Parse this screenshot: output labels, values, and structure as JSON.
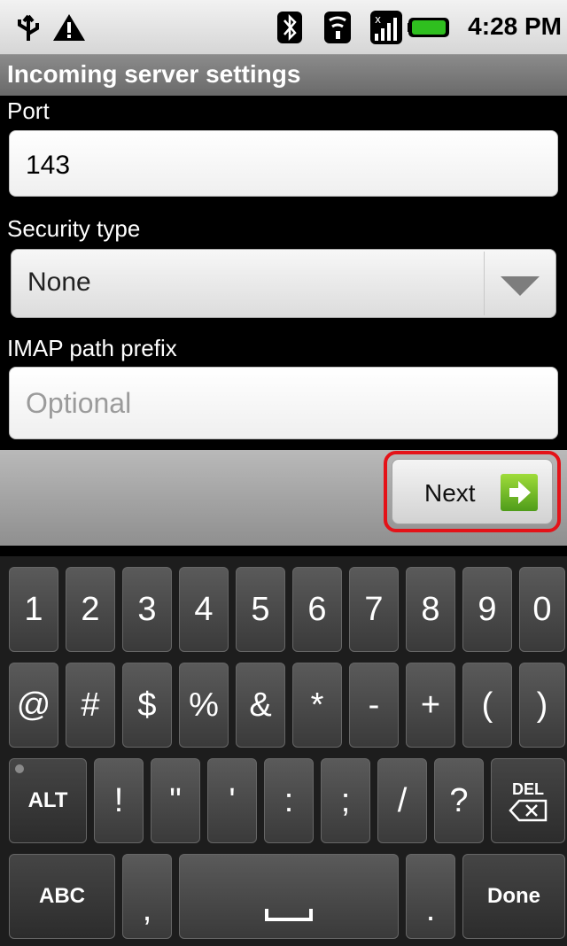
{
  "status_bar": {
    "icons": [
      "usb-icon",
      "warning-icon",
      "bluetooth-icon",
      "wifi-icon",
      "signal-icon",
      "battery-icon"
    ],
    "time": "4:28 PM"
  },
  "title": "Incoming server settings",
  "form": {
    "port_label": "Port",
    "port_value": "143",
    "security_label": "Security type",
    "security_value": "None",
    "imap_label": "IMAP path prefix",
    "imap_placeholder": "Optional"
  },
  "next_button": {
    "label": "Next",
    "highlight_color": "#e41218"
  },
  "keyboard": {
    "row1": [
      "1",
      "2",
      "3",
      "4",
      "5",
      "6",
      "7",
      "8",
      "9",
      "0"
    ],
    "row2": [
      "@",
      "#",
      "$",
      "%",
      "&",
      "*",
      "-",
      "+",
      "(",
      ")"
    ],
    "row3": [
      "ALT",
      "!",
      "\"",
      "'",
      ":",
      ";",
      "/",
      "?",
      "DEL"
    ],
    "row4": [
      "ABC",
      ",",
      "",
      ".",
      "Done"
    ]
  }
}
